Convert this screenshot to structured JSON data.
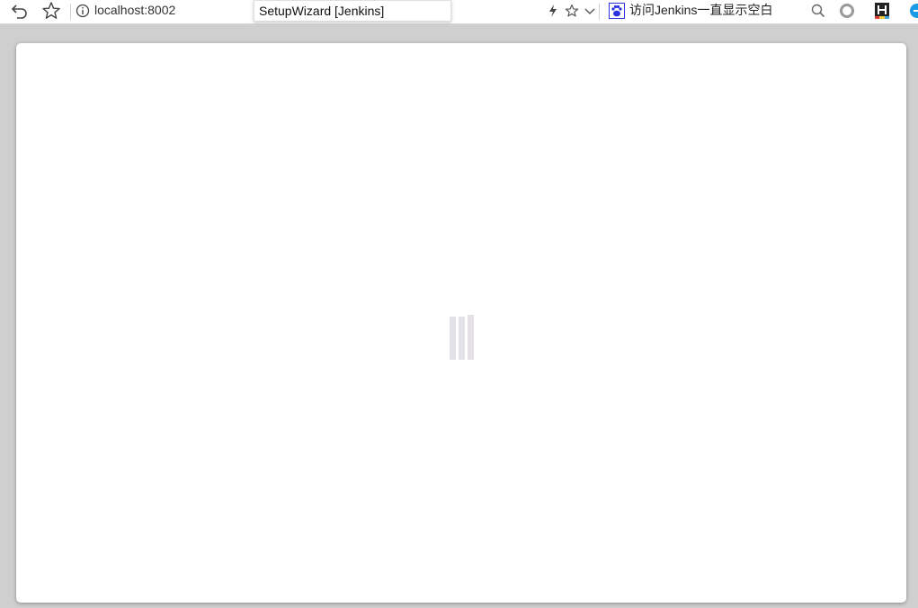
{
  "browser": {
    "address_bar": {
      "url": "localhost:8002"
    },
    "tab_tooltip": "SetupWizard [Jenkins]",
    "search_box": {
      "query": "访问Jenkins一直显示空白"
    },
    "icons": [
      "undo-icon",
      "bookmark-star-icon",
      "info-icon",
      "lightning-icon",
      "star-icon",
      "chevron-down-icon",
      "baidu-paw-icon",
      "search-icon",
      "circle-icon",
      "h-extension-icon",
      "blue-extension-icon"
    ]
  },
  "page": {
    "status": "loading",
    "colors": {
      "spinner": "#e5e2e7",
      "card": "#ffffff",
      "backdrop": "#cfcfcf"
    }
  }
}
